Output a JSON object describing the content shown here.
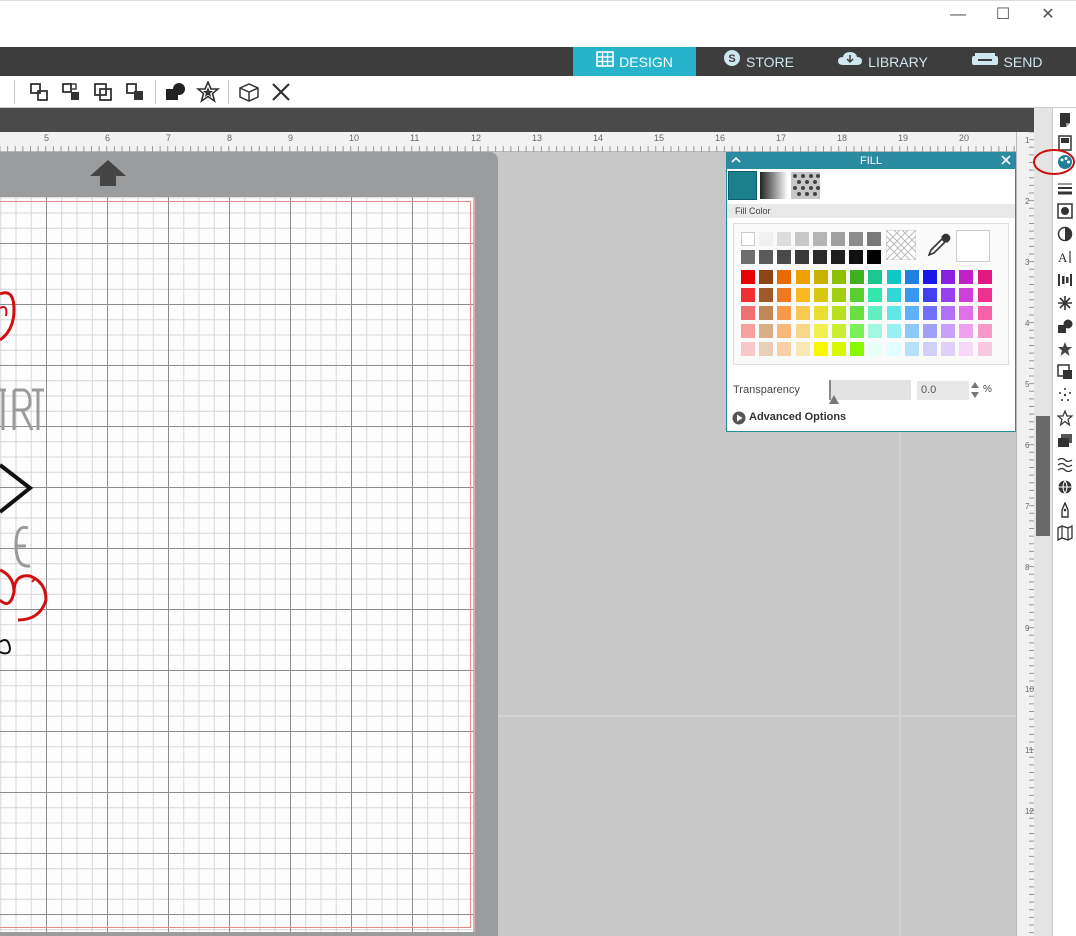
{
  "window": {
    "minimize": "—",
    "maximize": "☐",
    "close": "✕"
  },
  "nav": {
    "tabs": [
      {
        "label": "DESIGN",
        "active": true
      },
      {
        "label": "STORE"
      },
      {
        "label": "LIBRARY"
      },
      {
        "label": "SEND"
      }
    ]
  },
  "ruler": {
    "labels": [
      "5",
      "6",
      "7",
      "8",
      "9",
      "10",
      "11",
      "12",
      "13",
      "14",
      "15",
      "16",
      "17",
      "18",
      "19",
      "20"
    ]
  },
  "vruler": {
    "labels": [
      "1",
      "2",
      "3",
      "4",
      "5",
      "6",
      "7",
      "8",
      "9",
      "10",
      "11",
      "12"
    ]
  },
  "fill_panel": {
    "title": "FILL",
    "fill_color_label": "Fill Color",
    "transparency_label": "Transparency",
    "transparency_value": "0.0",
    "transparency_unit": "%",
    "advanced_label": "Advanced Options"
  },
  "colors": {
    "accent": "#26b3cc",
    "panel_header": "#2a8ba0",
    "selected_fill": "#1b7f8c",
    "highlight_circle": "#cc1111"
  },
  "palette": {
    "grays_row1": [
      "#ffffff",
      "#f0f0f0",
      "#dcdcdc",
      "#c8c8c8",
      "#b4b4b4",
      "#a0a0a0",
      "#8c8c8c",
      "#787878"
    ],
    "grays_row2": [
      "#6e6e6e",
      "#5a5a5a",
      "#4a4a4a",
      "#3a3a3a",
      "#2a2a2a",
      "#1e1e1e",
      "#111111",
      "#000000"
    ],
    "rows": [
      [
        "#e60000",
        "#8b4513",
        "#e86a00",
        "#f0a000",
        "#c8b400",
        "#8cc000",
        "#40b020",
        "#18c890",
        "#10c8c8",
        "#2080e0",
        "#1818e8",
        "#8820e0",
        "#c020c8",
        "#e01880"
      ],
      [
        "#f03030",
        "#a05a2a",
        "#f07820",
        "#f8b820",
        "#d8c810",
        "#a0d010",
        "#58d030",
        "#30e8a8",
        "#30d8d8",
        "#3898f0",
        "#4040f0",
        "#9840f0",
        "#d040d8",
        "#f03090"
      ],
      [
        "#f07070",
        "#c08858",
        "#f89848",
        "#f8c850",
        "#e8e030",
        "#b8e020",
        "#68e040",
        "#60f0c0",
        "#60e8e8",
        "#60b0f8",
        "#7070f8",
        "#b070f8",
        "#e070e8",
        "#f860a8"
      ],
      [
        "#f8a0a0",
        "#d8b088",
        "#f8b878",
        "#f8d888",
        "#f0f050",
        "#c8f030",
        "#78f058",
        "#a0f8e0",
        "#98f0f0",
        "#90c8f8",
        "#a0a0f8",
        "#c8a0f8",
        "#f0a0f0",
        "#f898c8"
      ],
      [
        "#f8c8c8",
        "#e8d0b8",
        "#f8d0a8",
        "#f8e8b8",
        "#f8f800",
        "#d8f800",
        "#88f800",
        "#e8fff8",
        "#e0ffff",
        "#b8e0f8",
        "#d0d0f8",
        "#e0d0f8",
        "#f8d8f8",
        "#f8c8e0"
      ]
    ]
  },
  "icons": {
    "panel_icons": [
      "page-setup-icon",
      "library-icon",
      "fill-icon",
      "line-icon",
      "image-trace-icon",
      "contrast-icon",
      "text-icon",
      "align-icon",
      "replicate-icon",
      "modify-icon",
      "star-icon",
      "transform-icon",
      "sparkle-icon",
      "star-outline-icon",
      "layers-icon",
      "pattern-icon",
      "globe-icon",
      "pen-icon",
      "map-icon"
    ]
  }
}
